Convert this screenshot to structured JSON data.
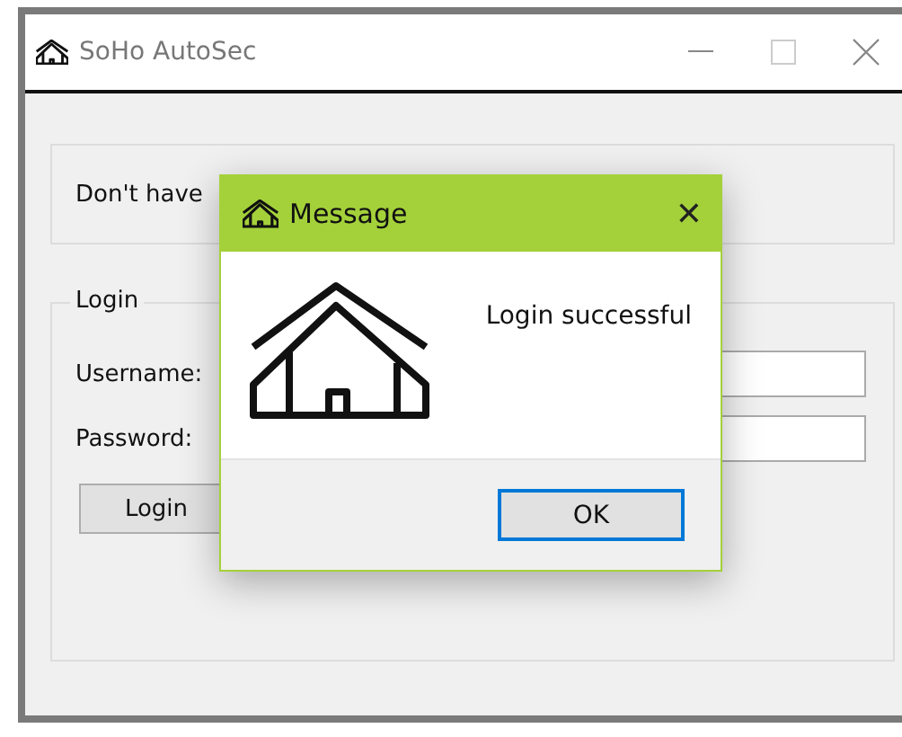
{
  "window": {
    "title": "SoHo AutoSec"
  },
  "signup_group": {
    "text": "Don't have"
  },
  "login_group": {
    "title": "Login",
    "fields": [
      {
        "label": "Username:"
      },
      {
        "label": "Password:"
      }
    ],
    "button": "Login"
  },
  "dialog": {
    "title": "Message",
    "close": "✕",
    "message": "Login successful",
    "button": "OK",
    "button_focused": true
  }
}
